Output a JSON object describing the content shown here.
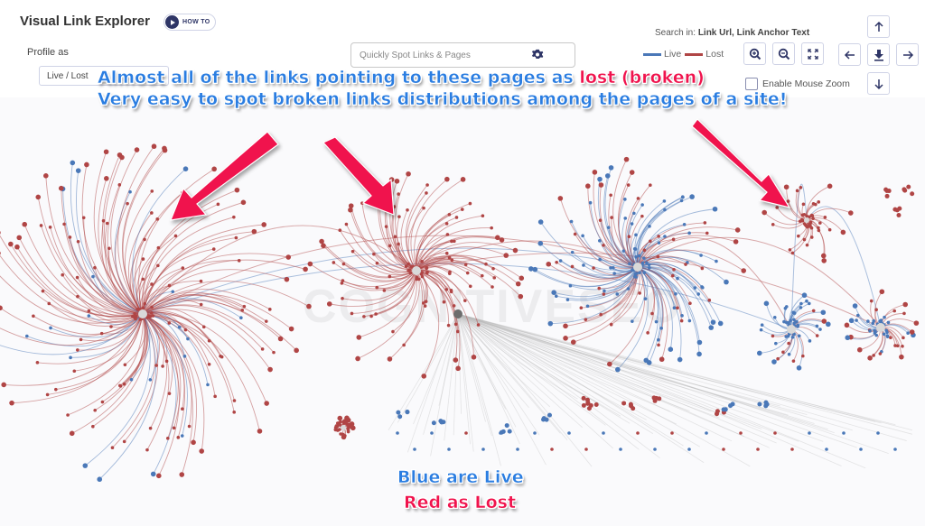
{
  "header": {
    "title": "Visual Link Explorer",
    "howto_label": "HOW TO"
  },
  "profile": {
    "label": "Profile as",
    "selected": "Live / Lost"
  },
  "search": {
    "placeholder": "Quickly Spot Links & Pages",
    "value": "",
    "icon": "gear-icon"
  },
  "search_in": {
    "prefix": "Search in:",
    "fields": "Link Url, Link Anchor Text"
  },
  "legend": [
    {
      "label": "Live",
      "color": "#4a78b8"
    },
    {
      "label": "Lost",
      "color": "#b04545"
    }
  ],
  "controls": {
    "zoom_in": "zoom-in-icon",
    "zoom_out": "zoom-out-icon",
    "fit": "fit-screen-icon",
    "pan_up": "arrow-up-icon",
    "pan_left": "arrow-left-icon",
    "download": "download-icon",
    "pan_right": "arrow-right-icon",
    "pan_down": "arrow-down-icon",
    "mouse_zoom_label": "Enable Mouse Zoom",
    "mouse_zoom_checked": false
  },
  "watermark": "COGNITIVESEO",
  "annotations": {
    "line1_blue": "Almost all of the links pointing to these pages as ",
    "line1_red": "lost (broken)",
    "line2": "Very easy to spot broken links distributions among the pages of a site!",
    "bottom_blue": "Blue are Live",
    "bottom_red": "Red as Lost"
  },
  "colors": {
    "live": "#4a78b8",
    "lost": "#b04545",
    "neutral": "#b9b9b9",
    "hub": "#d9d9d9",
    "arrow": "#f0134d",
    "annotation_blue": "#2a7de1"
  },
  "graph": {
    "clusters": [
      {
        "name": "cluster-left-lost-heavy",
        "hub": [
          158,
          348
        ],
        "spokes": 150,
        "live_share": 0.15,
        "radius": [
          30,
          190
        ],
        "swirl": 0.55
      },
      {
        "name": "cluster-center-lost",
        "hub": [
          461,
          300
        ],
        "spokes": 95,
        "live_share": 0.0,
        "radius": [
          30,
          120
        ],
        "swirl": 0.55
      },
      {
        "name": "cluster-right-live-heavy",
        "hub": [
          706,
          296
        ],
        "spokes": 130,
        "live_share": 0.68,
        "radius": [
          20,
          120
        ],
        "swirl": 0.5
      },
      {
        "name": "cluster-top-right-lost",
        "hub": [
          893,
          244
        ],
        "spokes": 28,
        "live_share": 0.0,
        "radius": [
          8,
          50
        ],
        "swirl": 0.4
      },
      {
        "name": "cluster-right-mixed-a",
        "hub": [
          876,
          365
        ],
        "spokes": 32,
        "live_share": 0.75,
        "radius": [
          15,
          45
        ],
        "swirl": 0.3
      },
      {
        "name": "cluster-right-mixed-b",
        "hub": [
          975,
          363
        ],
        "spokes": 30,
        "live_share": 0.6,
        "radius": [
          12,
          40
        ],
        "swirl": 0.3
      },
      {
        "name": "cluster-bottom-small-lost",
        "hub": [
          380,
          474
        ],
        "spokes": 22,
        "live_share": 0.0,
        "radius": [
          4,
          12
        ],
        "swirl": 0.2
      }
    ],
    "neutral_hub": [
      507,
      348
    ],
    "summary": {
      "live_label": "Live",
      "lost_label": "Lost"
    }
  }
}
